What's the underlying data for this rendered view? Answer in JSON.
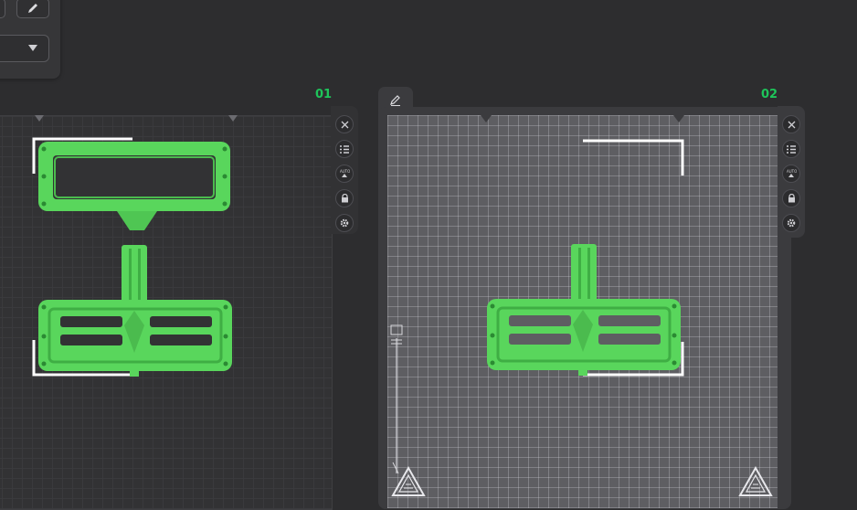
{
  "toolbar": {
    "edit_icon": "pencil-icon",
    "dropdown_icon": "dropdown-arrow-icon",
    "dropdown_value": ""
  },
  "plates": [
    {
      "label": "01",
      "tools": [
        "close-icon",
        "list-icon",
        "auto-orient-icon",
        "lock-icon",
        "settings-icon"
      ]
    },
    {
      "label": "02",
      "tools": [
        "close-icon",
        "list-icon",
        "auto-orient-icon",
        "lock-icon",
        "settings-icon"
      ]
    }
  ],
  "plate_tab_icon": "pencil-icon",
  "colors": {
    "background": "#2d2d2f",
    "label_green": "#1ec45a",
    "model_green": "#59d65c",
    "plate_dark": "#323234",
    "plate_light": "#5e5e62"
  }
}
